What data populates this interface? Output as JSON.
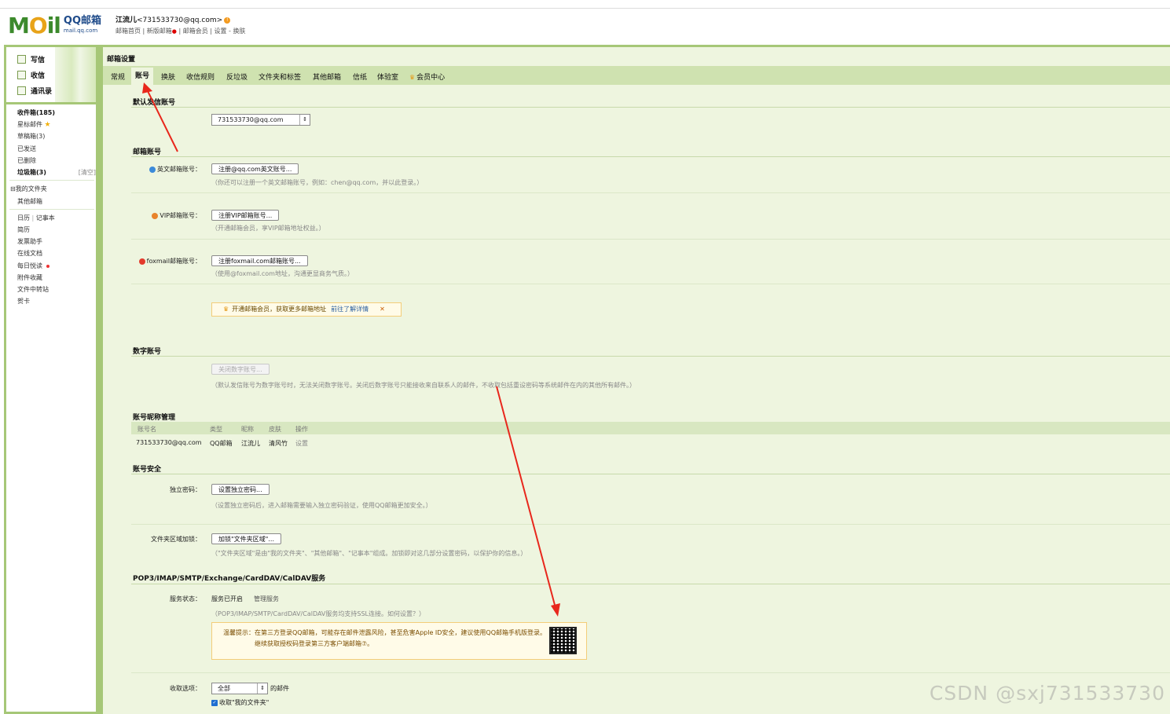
{
  "header": {
    "logo_text_left": "M",
    "logo_text_o": "O",
    "logo_text_right": "il",
    "logo_brand": "QQ邮箱",
    "logo_domain": "mail.qq.com",
    "user_name": "江流儿",
    "user_email": "<731533730@qq.com>",
    "warning_badge": "!",
    "link_home": "邮箱首页",
    "link_new": "新版邮箱",
    "link_new_dot": "●",
    "link_vip": "邮箱会员",
    "link_settings": "设置",
    "link_skin": "换肤",
    "sep_pipe": "|",
    "sep_dash": "-"
  },
  "sidebar": {
    "compose": "写信",
    "inbox_btn": "收信",
    "contacts": "通讯录",
    "inbox": "收件箱(185)",
    "starred": "星标邮件",
    "star_glyph": "★",
    "drafts": "草稿箱(3)",
    "sent": "已发送",
    "deleted": "已删除",
    "junk": "垃圾箱(3)",
    "junk_clear": "[清空]",
    "my_folders_toggle": "⊟",
    "my_folders": "我的文件夹",
    "other_mail": "其他邮箱",
    "calendar": "日历",
    "notebook": "记事本",
    "resume": "简历",
    "invoice": "发票助手",
    "online_docs": "在线文档",
    "daily_reading": "每日悦读",
    "attachments": "附件收藏",
    "file_transfer": "文件中转站",
    "cards": "贺卡"
  },
  "main": {
    "title": "邮箱设置",
    "tabs": [
      "常规",
      "账号",
      "换肤",
      "收信规则",
      "反垃圾",
      "文件夹和标签",
      "其他邮箱",
      "信纸",
      "体验室",
      "会员中心"
    ],
    "tab_crown": "♛",
    "default_sender_section": "默认发信账号",
    "default_sender_value": "731533730@qq.com",
    "select_arrow": "⇕",
    "mail_accounts_section": "邮箱账号",
    "english_label": "英文邮箱账号：",
    "english_btn": "注册@qq.com英文账号...",
    "english_hint": "（你还可以注册一个英文邮箱账号，例如：chen@qq.com，并以此登录。）",
    "vip_label": "VIP邮箱账号：",
    "vip_btn": "注册VIP邮箱账号...",
    "vip_hint": "（开通邮箱会员，享VIP邮箱地址权益。）",
    "foxmail_label": "foxmail邮箱账号：",
    "foxmail_btn": "注册foxmail.com邮箱账号...",
    "foxmail_hint": "（使用@foxmail.com地址，沟通更显商务气质。）",
    "notice_text": "开通邮箱会员，获取更多邮箱地址",
    "notice_link": "前往了解详情",
    "notice_close": "✕",
    "digital_section": "数字账号",
    "digital_btn": "关闭数字账号...",
    "digital_hint": "（默认发信账号为数字账号时，无法关闭数字账号。关闭后数字账号只能接收来自联系人的邮件，不收取包括重设密码等系统邮件在内的其他所有邮件。）",
    "nickname_section": "账号昵称管理",
    "nickname_headers": [
      "账号名",
      "类型",
      "昵称",
      "皮肤",
      "操作"
    ],
    "nickname_row": [
      "731533730@qq.com",
      "QQ邮箱",
      "江流儿",
      "清风竹",
      "设置"
    ],
    "security_section": "账号安全",
    "pwd_label": "独立密码：",
    "pwd_btn": "设置独立密码...",
    "pwd_hint": "（设置独立密码后，进入邮箱需要输入独立密码验证，使用QQ邮箱更加安全。）",
    "folderlock_label": "文件夹区域加锁：",
    "folderlock_btn": "加锁\"文件夹区域\"...",
    "folderlock_hint": "（\"文件夹区域\"是由\"我的文件夹\"、\"其他邮箱\"、\"记事本\"组成。加锁即对这几部分设置密码，以保护你的信息。）",
    "pop_section": "POP3/IMAP/SMTP/Exchange/CardDAV/CalDAV服务",
    "svc_label": "服务状态：",
    "svc_status": "服务已开启",
    "svc_manage": "管理服务",
    "svc_hint": "（POP3/IMAP/SMTP/CardDAV/CalDAV服务均支持SSL连接。如何设置？）",
    "warn_title": "温馨提示：",
    "warn_line1": "在第三方登录QQ邮箱，可能存在邮件泄露风险，甚至危害Apple ID安全，建议使用QQ邮箱手机版登录。",
    "warn_line2": "继续获取授权码登录第三方客户端邮箱⑦。",
    "recv_label": "收取选项：",
    "recv_select": "全部",
    "recv_suffix": "的邮件",
    "recv_check": "收取\"我的文件夹\"",
    "check_glyph": "✓"
  },
  "watermark": "CSDN @sxj731533730",
  "colors": {
    "accent_green": "#a6c777",
    "panel_bg": "#eef5df",
    "tab_bg": "#cfe2b0",
    "arrow_red": "#e8271c"
  }
}
